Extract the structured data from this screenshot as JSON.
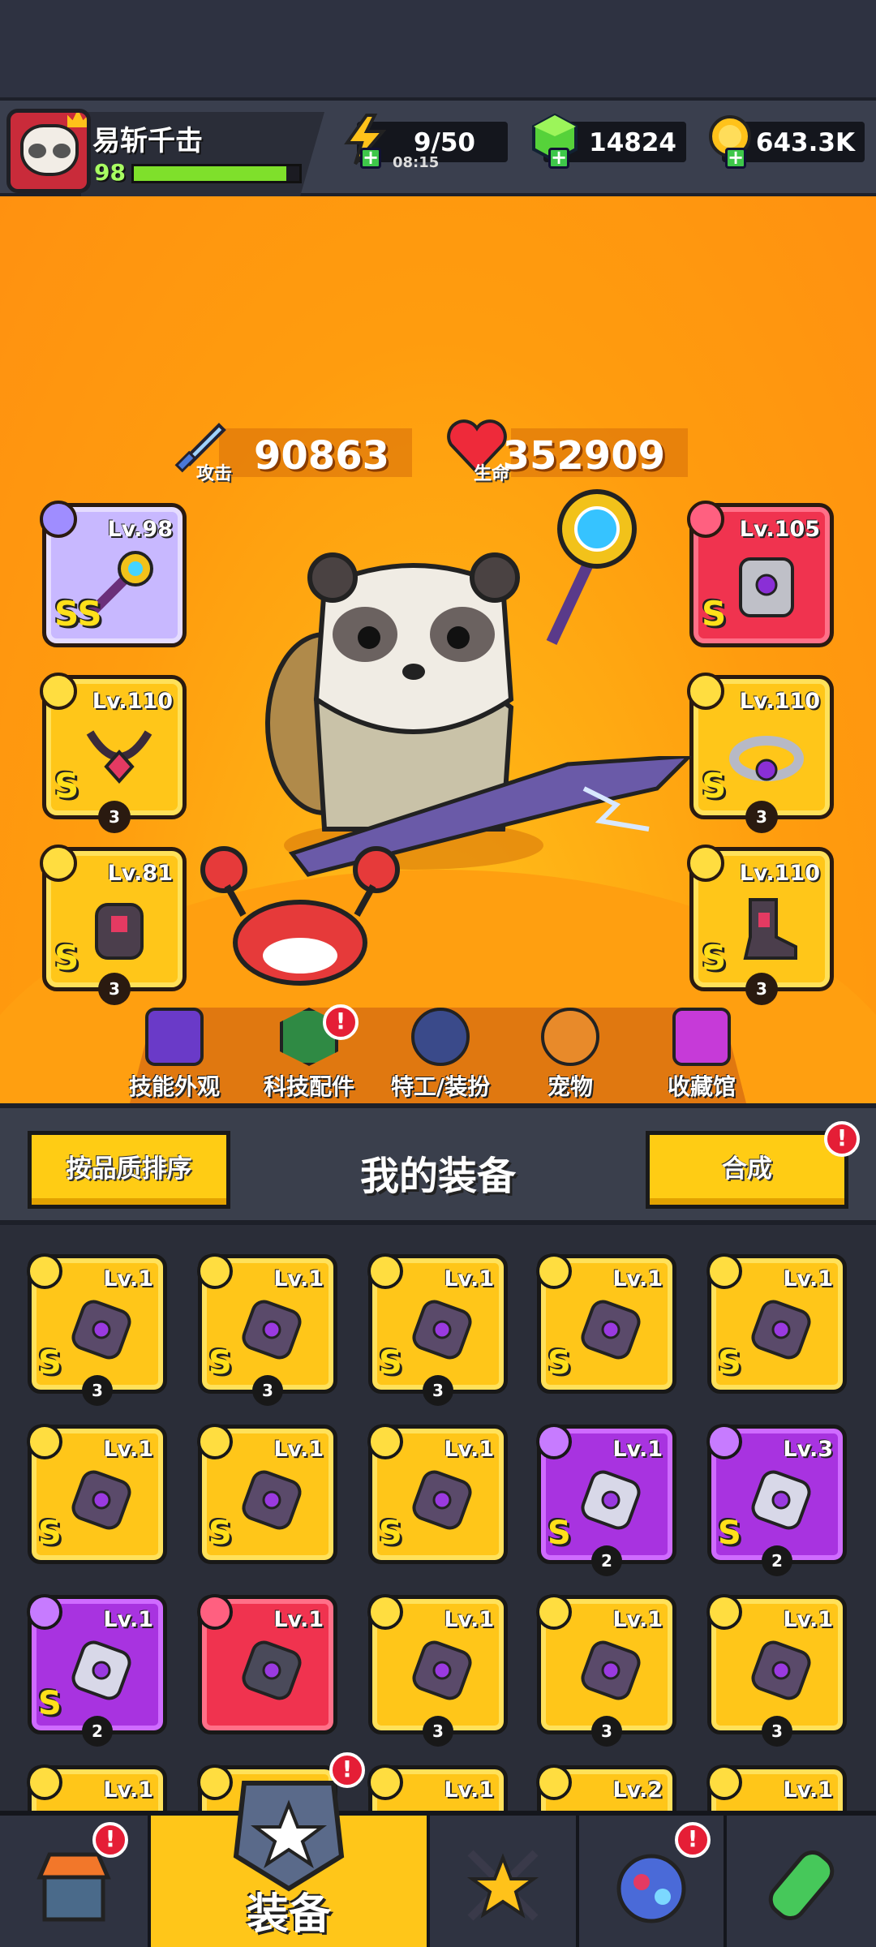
{
  "player": {
    "name": "易斩千击",
    "level": "98",
    "xp_fraction": 0.92
  },
  "resources": {
    "energy": {
      "value": "9/50",
      "timer": "08:15",
      "icon": "lightning-icon"
    },
    "gems": {
      "value": "14824",
      "icon": "green-gem-icon"
    },
    "coins": {
      "value": "643.3K",
      "icon": "gold-coin-icon"
    }
  },
  "stats": {
    "attack": {
      "label": "攻击",
      "value": "90863",
      "icon": "sword-icon"
    },
    "hp": {
      "label": "生命",
      "value": "352909",
      "icon": "heart-icon"
    }
  },
  "equipped": [
    {
      "slot": "weapon",
      "level": "Lv.98",
      "grade": "SS",
      "rarity": "lavender",
      "icon": "staff-weapon-icon"
    },
    {
      "slot": "armor",
      "level": "Lv.105",
      "grade": "S",
      "rarity": "red",
      "icon": "armor-icon"
    },
    {
      "slot": "necklace",
      "level": "Lv.110",
      "grade": "S",
      "rarity": "gold",
      "stars": "3",
      "icon": "necklace-icon"
    },
    {
      "slot": "belt",
      "level": "Lv.110",
      "grade": "S",
      "rarity": "gold",
      "stars": "3",
      "icon": "belt-icon"
    },
    {
      "slot": "gloves",
      "level": "Lv.81",
      "grade": "S",
      "rarity": "gold",
      "stars": "3",
      "icon": "gloves-icon"
    },
    {
      "slot": "boots",
      "level": "Lv.110",
      "grade": "S",
      "rarity": "gold",
      "stars": "3",
      "icon": "boots-icon"
    }
  ],
  "hero_menu": [
    {
      "label": "技能外观",
      "icon": "skill-skin-icon"
    },
    {
      "label": "科技配件",
      "icon": "tech-part-icon",
      "alert": "!"
    },
    {
      "label": "特工/装扮",
      "icon": "agent-icon"
    },
    {
      "label": "宠物",
      "icon": "pet-icon"
    },
    {
      "label": "收藏馆",
      "icon": "collection-icon"
    }
  ],
  "equipment_panel": {
    "sort_label": "按品质排序",
    "title": "我的装备",
    "merge_label": "合成",
    "merge_alert": "!"
  },
  "inventory": [
    {
      "level": "Lv.1",
      "grade": "S",
      "rarity": "gold",
      "count": "3",
      "icon": "dark-blade-icon"
    },
    {
      "level": "Lv.1",
      "grade": "S",
      "rarity": "gold",
      "count": "3",
      "icon": "dark-blade-icon"
    },
    {
      "level": "Lv.1",
      "grade": "S",
      "rarity": "gold",
      "count": "3",
      "icon": "dark-necklace-icon"
    },
    {
      "level": "Lv.1",
      "grade": "S",
      "rarity": "gold",
      "count": "",
      "icon": "robot-armor-icon"
    },
    {
      "level": "Lv.1",
      "grade": "S",
      "rarity": "gold",
      "count": "",
      "icon": "dark-armor-icon"
    },
    {
      "level": "Lv.1",
      "grade": "S",
      "rarity": "gold",
      "count": "",
      "icon": "dark-armor-icon"
    },
    {
      "level": "Lv.1",
      "grade": "S",
      "rarity": "gold",
      "count": "",
      "icon": "star-necklace-icon"
    },
    {
      "level": "Lv.1",
      "grade": "S",
      "rarity": "gold",
      "count": "",
      "icon": "mech-glove-icon"
    },
    {
      "level": "Lv.1",
      "grade": "S",
      "rarity": "purple",
      "count": "2",
      "icon": "fire-sword-icon"
    },
    {
      "level": "Lv.3",
      "grade": "S",
      "rarity": "purple",
      "count": "2",
      "icon": "silver-glove-icon"
    },
    {
      "level": "Lv.1",
      "grade": "S",
      "rarity": "purple",
      "count": "2",
      "icon": "dark-glove-icon"
    },
    {
      "level": "Lv.1",
      "grade": "",
      "rarity": "red",
      "count": "",
      "icon": "kunai-icon"
    },
    {
      "level": "Lv.1",
      "grade": "",
      "rarity": "gold",
      "count": "3",
      "icon": "emerald-ring-icon"
    },
    {
      "level": "Lv.1",
      "grade": "",
      "rarity": "gold",
      "count": "3",
      "icon": "bone-belt-icon"
    },
    {
      "level": "Lv.1",
      "grade": "",
      "rarity": "gold",
      "count": "3",
      "icon": "star-belt-icon"
    },
    {
      "level": "Lv.1",
      "grade": "",
      "rarity": "gold",
      "count": "",
      "icon": "belt-icon"
    },
    {
      "level": "",
      "grade": "",
      "rarity": "gold",
      "count": "",
      "icon": "item-icon"
    },
    {
      "level": "Lv.1",
      "grade": "",
      "rarity": "gold",
      "count": "",
      "icon": "gloves-icon"
    },
    {
      "level": "Lv.2",
      "grade": "",
      "rarity": "gold",
      "count": "",
      "icon": "boots-icon"
    },
    {
      "level": "Lv.1",
      "grade": "",
      "rarity": "gold",
      "count": "",
      "icon": "belt-icon"
    }
  ],
  "nav": [
    {
      "label": "",
      "icon": "shop-icon",
      "alert": "!"
    },
    {
      "label": "装备",
      "icon": "equipment-icon",
      "alert": "!",
      "active": true
    },
    {
      "label": "",
      "icon": "battle-star-icon"
    },
    {
      "label": "",
      "icon": "egg-icon",
      "alert": "!"
    },
    {
      "label": "",
      "icon": "dna-capsule-icon"
    }
  ],
  "colors": {
    "hero_bg": "#ff9c0e",
    "gold_rarity": "#ffc619",
    "purple_rarity": "#a833e0",
    "red_rarity": "#f0334f",
    "alert_red": "#e51e36"
  }
}
